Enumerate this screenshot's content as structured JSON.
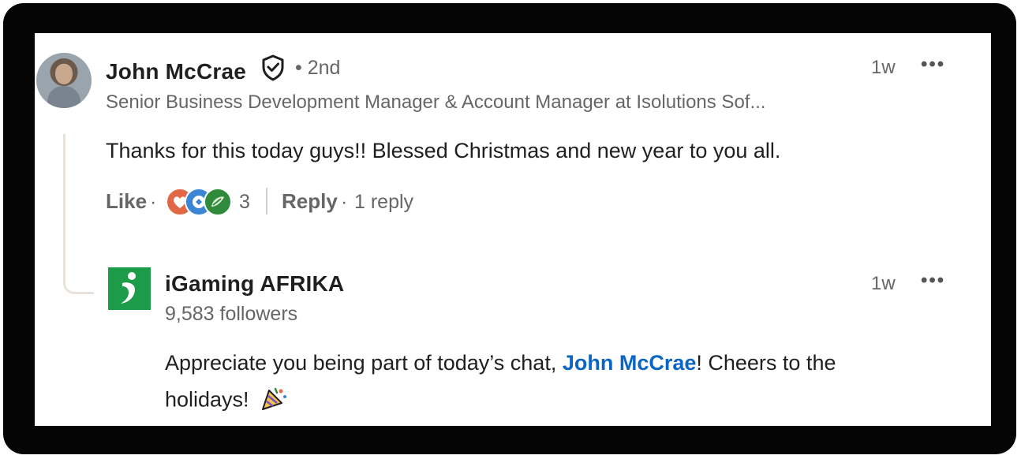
{
  "comment": {
    "author_name": "John McCrae",
    "verified_icon": "shield-check-icon",
    "connection_degree": "• 2nd",
    "headline": "Senior Business Development Manager & Account Manager at Isolutions Sof...",
    "time": "1w",
    "more_label": "•••",
    "text": "Thanks for this today guys!! Blessed Christmas and new year to you all.",
    "actions": {
      "like_label": "Like",
      "sep1": "·",
      "reaction_count": "3",
      "reply_label": "Reply",
      "sep2": "·",
      "replies_label": "1 reply"
    },
    "reaction_icons": [
      "love-reaction-icon",
      "celebrate-reaction-icon",
      "insightful-reaction-icon"
    ]
  },
  "reply": {
    "author_name": "iGaming AFRIKA",
    "followers": "9,583 followers",
    "time": "1w",
    "more_label": "•••",
    "text_part1": "Appreciate you being part of today’s chat, ",
    "mention": "John McCrae",
    "text_part2": "! Cheers to the",
    "text_line2": "holidays!",
    "emoji_icon": "party-popper-icon"
  },
  "colors": {
    "mention": "#0a66c2",
    "logo_green": "#1c9b48",
    "muted_text": "#666666"
  }
}
